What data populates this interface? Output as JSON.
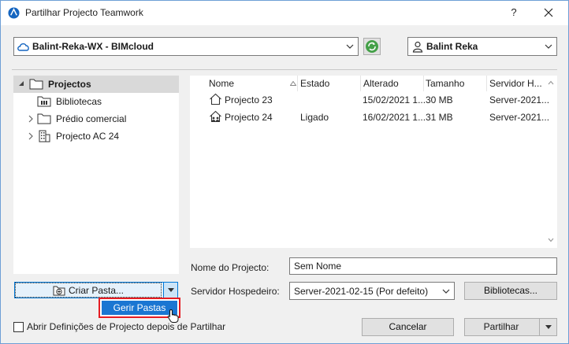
{
  "window": {
    "title": "Partilhar Projecto Teamwork",
    "help": "?"
  },
  "server_combo": {
    "value": "Balint-Reka-WX - BIMcloud"
  },
  "user_combo": {
    "value": "Balint Reka"
  },
  "tree": {
    "items": [
      {
        "label": "Projectos"
      },
      {
        "label": "Bibliotecas"
      },
      {
        "label": "Prédio comercial"
      },
      {
        "label": "Projecto AC 24"
      }
    ]
  },
  "list": {
    "columns": [
      "Nome",
      "Estado",
      "Alterado",
      "Tamanho",
      "Servidor H..."
    ],
    "rows": [
      {
        "name": "Projecto 23",
        "state": "",
        "changed": "15/02/2021 1...",
        "size": "30 MB",
        "server": "Server-2021..."
      },
      {
        "name": "Projecto 24",
        "state": "Ligado",
        "changed": "16/02/2021 1...",
        "size": "31 MB",
        "server": "Server-2021..."
      }
    ]
  },
  "project_name": {
    "label": "Nome do Projecto:",
    "value": "Sem Nome"
  },
  "host_server": {
    "label": "Servidor Hospedeiro:",
    "value": "Server-2021-02-15 (Por defeito)"
  },
  "buttons": {
    "libraries": "Bibliotecas...",
    "create_folder": "Criar Pasta...",
    "manage_folders": "Gerir Pastas",
    "cancel": "Cancelar",
    "share": "Partilhar"
  },
  "checkbox": {
    "label": "Abrir Definições de Projecto depois de Partilhar",
    "checked": false
  },
  "colors": {
    "accent": "#0078d7",
    "highlight": "#e51c23",
    "menu_selected": "#1a76d2"
  }
}
